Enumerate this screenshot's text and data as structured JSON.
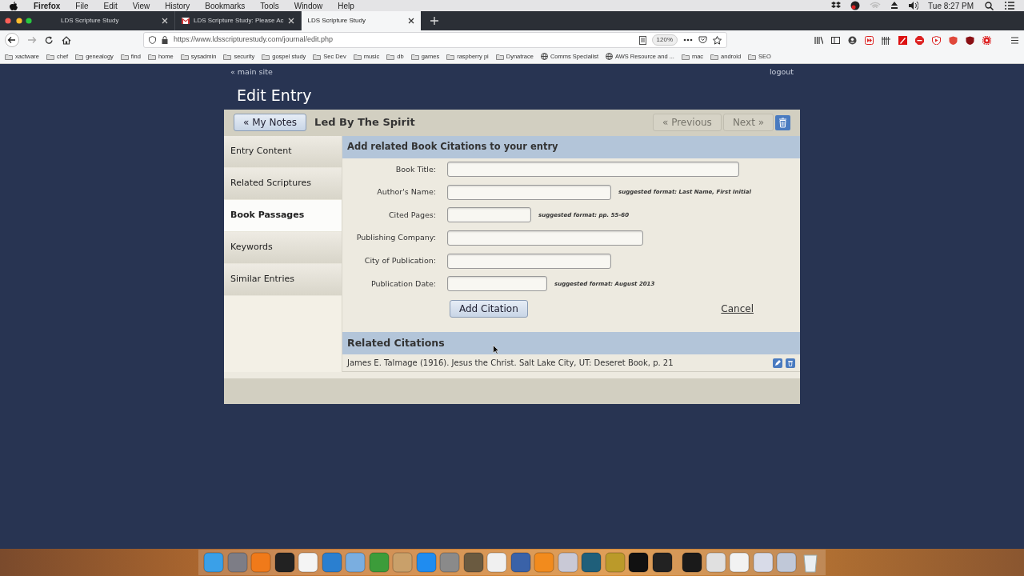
{
  "menu_bar": {
    "app": "Firefox",
    "menus": [
      "File",
      "Edit",
      "View",
      "History",
      "Bookmarks",
      "Tools",
      "Window",
      "Help"
    ],
    "clock": "Tue 8:27 PM"
  },
  "browser": {
    "tabs": [
      {
        "title": "LDS Scripture Study",
        "selected": false,
        "kind": "plain"
      },
      {
        "title": "LDS Scripture Study: Please Ac",
        "selected": false,
        "kind": "mail"
      },
      {
        "title": "LDS Scripture Study",
        "selected": true,
        "kind": "plain"
      }
    ],
    "url": "https://www.ldsscripturestudy.com/journal/edit.php",
    "zoom": "120%",
    "bookmarks": [
      {
        "label": "xactware",
        "kind": "folder"
      },
      {
        "label": "chef",
        "kind": "folder"
      },
      {
        "label": "genealogy",
        "kind": "folder"
      },
      {
        "label": "find",
        "kind": "folder"
      },
      {
        "label": "home",
        "kind": "folder"
      },
      {
        "label": "sysadmin",
        "kind": "folder"
      },
      {
        "label": "security",
        "kind": "folder"
      },
      {
        "label": "gospel study",
        "kind": "folder"
      },
      {
        "label": "Sec Dev",
        "kind": "folder"
      },
      {
        "label": "music",
        "kind": "folder"
      },
      {
        "label": "db",
        "kind": "folder"
      },
      {
        "label": "games",
        "kind": "folder"
      },
      {
        "label": "raspberry pi",
        "kind": "folder"
      },
      {
        "label": "Dynatrace",
        "kind": "folder"
      },
      {
        "label": "Comms Specialist",
        "kind": "site"
      },
      {
        "label": "AWS Resource and ...",
        "kind": "site"
      },
      {
        "label": "mac",
        "kind": "folder"
      },
      {
        "label": "android",
        "kind": "folder"
      },
      {
        "label": "SEO",
        "kind": "folder"
      }
    ]
  },
  "page": {
    "main_site_link": "« main site",
    "logout_link": "logout",
    "title": "Edit Entry",
    "back_button": "« My Notes",
    "entry_title": "Led By The Spirit",
    "previous_button": {
      "label": "« Previous",
      "disabled": true
    },
    "next_button": {
      "label": "Next »",
      "disabled": true
    },
    "sidebar": [
      {
        "label": "Entry Content",
        "selected": false
      },
      {
        "label": "Related Scriptures",
        "selected": false
      },
      {
        "label": "Book Passages",
        "selected": true
      },
      {
        "label": "Keywords",
        "selected": false
      },
      {
        "label": "Similar Entries",
        "selected": false
      }
    ],
    "form": {
      "heading": "Add related Book Citations to your entry",
      "fields": [
        {
          "label": "Book Title:"
        },
        {
          "label": "Author's Name:",
          "hint": "suggested format: Last Name, First Initial"
        },
        {
          "label": "Cited Pages:",
          "hint": "suggested format: pp. 55-60"
        },
        {
          "label": "Publishing Company:"
        },
        {
          "label": "City of Publication:"
        },
        {
          "label": "Publication Date:",
          "hint": "suggested format: August 2013"
        }
      ],
      "submit_button": "Add Citation",
      "cancel_link": "Cancel"
    },
    "citations": {
      "heading": "Related Citations",
      "items": [
        "James E. Talmage (1916). Jesus the Christ. Salt Lake City, UT: Deseret Book, p. 21"
      ]
    }
  }
}
